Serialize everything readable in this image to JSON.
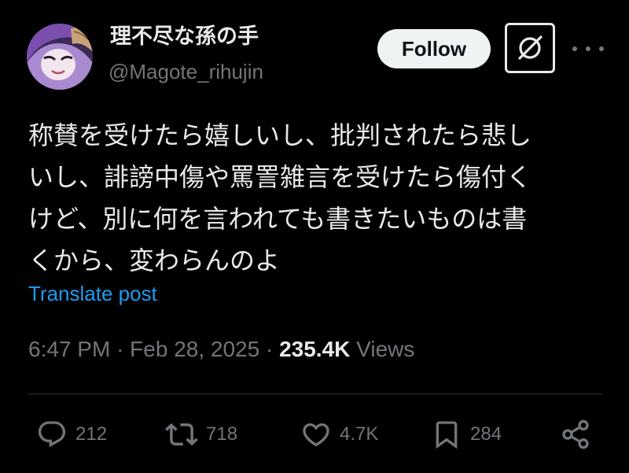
{
  "author": {
    "display_name": "理不尽な孫の手",
    "handle": "@Magote_rihujin"
  },
  "header_actions": {
    "follow_label": "Follow",
    "grok_icon": "grok-icon",
    "more_icon": "more-icon"
  },
  "tweet": {
    "lines": [
      "称賛を受けたら嬉しいし、批判されたら悲し",
      "いし、誹謗中傷や罵詈雑言を受けたら傷付く",
      "けど、別に何を言われても書きたいものは書",
      "くから、変わらんのよ"
    ],
    "translate_label": "Translate post"
  },
  "meta": {
    "time": "6:47 PM",
    "separator": "·",
    "date": "Feb 28, 2025",
    "views_count": "235.4K",
    "views_label": "Views"
  },
  "actions": {
    "replies": {
      "icon": "reply-icon",
      "count": "212"
    },
    "reposts": {
      "icon": "repost-icon",
      "count": "718"
    },
    "likes": {
      "icon": "heart-icon",
      "count": "4.7K"
    },
    "bookmarks": {
      "icon": "bookmark-icon",
      "count": "284"
    },
    "share": {
      "icon": "share-icon"
    }
  },
  "colors": {
    "background": "#000000",
    "text_primary": "#e7e9ea",
    "text_secondary": "#71767b",
    "link": "#1d9bf0",
    "follow_button_bg": "#eff3f4",
    "divider": "#2f3336"
  }
}
